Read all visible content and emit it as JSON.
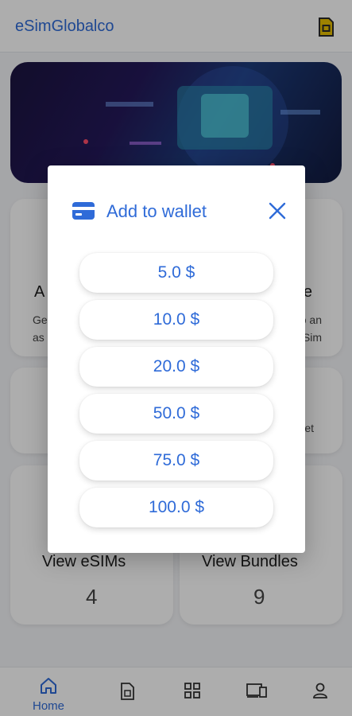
{
  "app": {
    "title": "eSimGlobalco"
  },
  "cards": {
    "card1": {
      "title": "A",
      "text_l1": "Ge",
      "text_l2": "as"
    },
    "card2": {
      "title": "e",
      "text_l1": "o an",
      "text_l2": "Sim"
    },
    "card4": {
      "text": "et"
    },
    "esims": {
      "title": "View eSIMs",
      "count": "4"
    },
    "bundles": {
      "title": "View Bundles",
      "count": "9"
    }
  },
  "modal": {
    "title": "Add to wallet",
    "amounts": [
      "5.0 $",
      "10.0 $",
      "20.0 $",
      "50.0 $",
      "75.0 $",
      "100.0 $"
    ]
  },
  "nav": {
    "home_label": "Home"
  },
  "colors": {
    "accent": "#2f6bd8",
    "overlay": "rgba(0,0,0,0.32)",
    "sim_icon": "#e8c000"
  }
}
